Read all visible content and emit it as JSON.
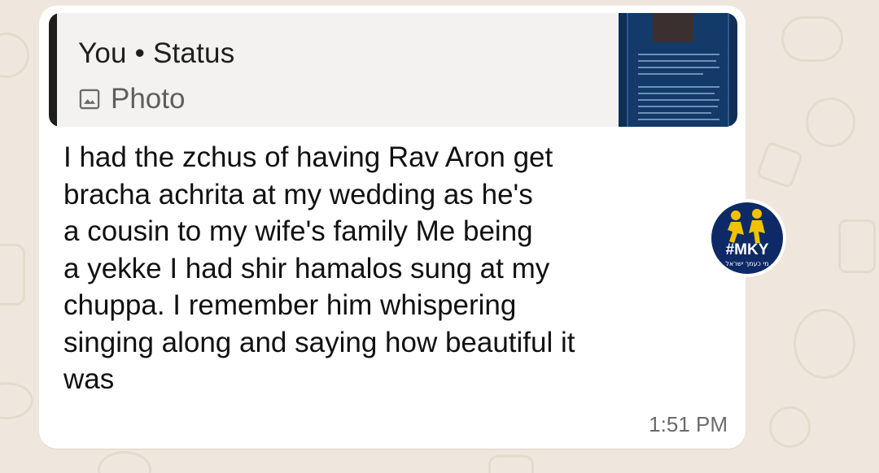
{
  "colors": {
    "wallpaper": "#efe7dd",
    "bubble": "#ffffff",
    "quote_background": "#f3f2f0",
    "quote_bar": "#1e1e1e",
    "badge_blue": "#0e2a66",
    "badge_yellow": "#f2c200"
  },
  "quoted": {
    "author": "You • Status",
    "type_icon": "photo-icon",
    "type_label": "Photo"
  },
  "message": {
    "text": "I had the zchus of having Rav Aron get\nbracha achrita at my wedding as he's\na cousin to my wife's family Me being\na yekke I had shir hamalos sung at my\nchuppa. I remember him whispering\nsinging along and saying how beautiful it\nwas",
    "time": "1:51 PM"
  },
  "watermark": {
    "title": "#MKY",
    "subtitle": "מי כעמך ישראל"
  }
}
